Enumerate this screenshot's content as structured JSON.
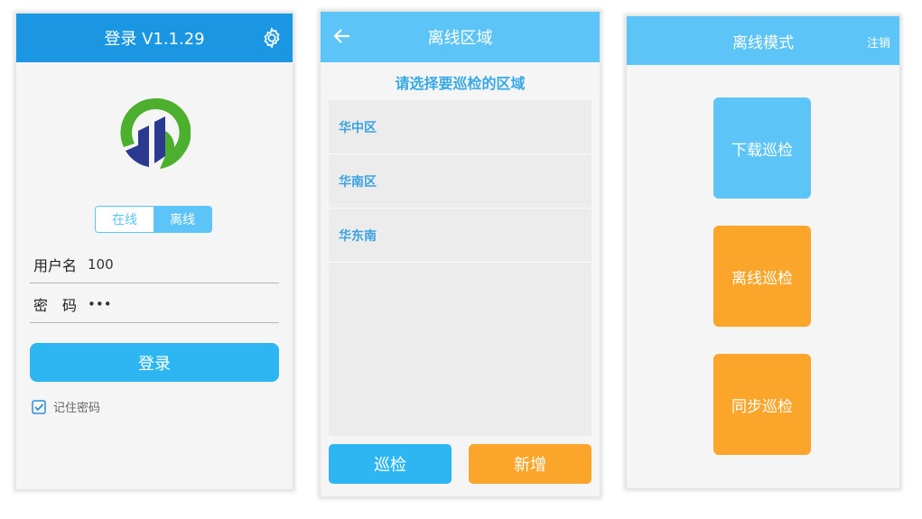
{
  "login": {
    "title": "登录 V1.1.29",
    "mode_online": "在线",
    "mode_offline": "离线",
    "username_label": "用户名",
    "username_value": "100",
    "password_label": "密　码",
    "password_value": "•••",
    "login_button": "登录",
    "remember_password": "记住密码"
  },
  "region": {
    "title": "离线区域",
    "prompt": "请选择要巡检的区域",
    "items": [
      "华中区",
      "华南区",
      "华东南"
    ],
    "patrol_button": "巡检",
    "add_button": "新增"
  },
  "offline": {
    "title": "离线模式",
    "logout": "注销",
    "download": "下载巡检",
    "offline_patrol": "离线巡检",
    "sync_patrol": "同步巡检"
  },
  "colors": {
    "primary_blue": "#1a96e3",
    "light_blue": "#5cc4f7",
    "button_blue": "#2eb6f3",
    "orange": "#fba52b",
    "logo_green": "#4caf2e",
    "logo_navy": "#2b3990"
  },
  "icons": {
    "settings": "gear-icon",
    "back": "back-arrow-icon",
    "remember": "checkbox-checked-icon",
    "logo": "app-logo-icon"
  }
}
